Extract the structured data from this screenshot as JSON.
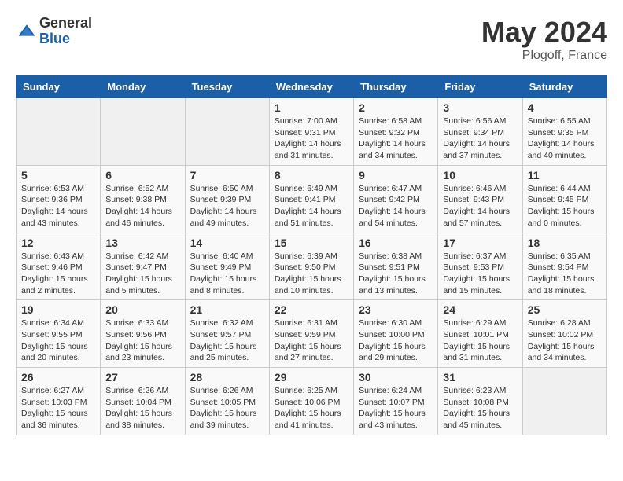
{
  "header": {
    "logo_general": "General",
    "logo_blue": "Blue",
    "month_year": "May 2024",
    "location": "Plogoff, France"
  },
  "days_of_week": [
    "Sunday",
    "Monday",
    "Tuesday",
    "Wednesday",
    "Thursday",
    "Friday",
    "Saturday"
  ],
  "weeks": [
    [
      {
        "day": "",
        "empty": true
      },
      {
        "day": "",
        "empty": true
      },
      {
        "day": "",
        "empty": true
      },
      {
        "day": "1",
        "sunrise": "7:00 AM",
        "sunset": "9:31 PM",
        "daylight": "14 hours and 31 minutes."
      },
      {
        "day": "2",
        "sunrise": "6:58 AM",
        "sunset": "9:32 PM",
        "daylight": "14 hours and 34 minutes."
      },
      {
        "day": "3",
        "sunrise": "6:56 AM",
        "sunset": "9:34 PM",
        "daylight": "14 hours and 37 minutes."
      },
      {
        "day": "4",
        "sunrise": "6:55 AM",
        "sunset": "9:35 PM",
        "daylight": "14 hours and 40 minutes."
      }
    ],
    [
      {
        "day": "5",
        "sunrise": "6:53 AM",
        "sunset": "9:36 PM",
        "daylight": "14 hours and 43 minutes."
      },
      {
        "day": "6",
        "sunrise": "6:52 AM",
        "sunset": "9:38 PM",
        "daylight": "14 hours and 46 minutes."
      },
      {
        "day": "7",
        "sunrise": "6:50 AM",
        "sunset": "9:39 PM",
        "daylight": "14 hours and 49 minutes."
      },
      {
        "day": "8",
        "sunrise": "6:49 AM",
        "sunset": "9:41 PM",
        "daylight": "14 hours and 51 minutes."
      },
      {
        "day": "9",
        "sunrise": "6:47 AM",
        "sunset": "9:42 PM",
        "daylight": "14 hours and 54 minutes."
      },
      {
        "day": "10",
        "sunrise": "6:46 AM",
        "sunset": "9:43 PM",
        "daylight": "14 hours and 57 minutes."
      },
      {
        "day": "11",
        "sunrise": "6:44 AM",
        "sunset": "9:45 PM",
        "daylight": "15 hours and 0 minutes."
      }
    ],
    [
      {
        "day": "12",
        "sunrise": "6:43 AM",
        "sunset": "9:46 PM",
        "daylight": "15 hours and 2 minutes."
      },
      {
        "day": "13",
        "sunrise": "6:42 AM",
        "sunset": "9:47 PM",
        "daylight": "15 hours and 5 minutes."
      },
      {
        "day": "14",
        "sunrise": "6:40 AM",
        "sunset": "9:49 PM",
        "daylight": "15 hours and 8 minutes."
      },
      {
        "day": "15",
        "sunrise": "6:39 AM",
        "sunset": "9:50 PM",
        "daylight": "15 hours and 10 minutes."
      },
      {
        "day": "16",
        "sunrise": "6:38 AM",
        "sunset": "9:51 PM",
        "daylight": "15 hours and 13 minutes."
      },
      {
        "day": "17",
        "sunrise": "6:37 AM",
        "sunset": "9:53 PM",
        "daylight": "15 hours and 15 minutes."
      },
      {
        "day": "18",
        "sunrise": "6:35 AM",
        "sunset": "9:54 PM",
        "daylight": "15 hours and 18 minutes."
      }
    ],
    [
      {
        "day": "19",
        "sunrise": "6:34 AM",
        "sunset": "9:55 PM",
        "daylight": "15 hours and 20 minutes."
      },
      {
        "day": "20",
        "sunrise": "6:33 AM",
        "sunset": "9:56 PM",
        "daylight": "15 hours and 23 minutes."
      },
      {
        "day": "21",
        "sunrise": "6:32 AM",
        "sunset": "9:57 PM",
        "daylight": "15 hours and 25 minutes."
      },
      {
        "day": "22",
        "sunrise": "6:31 AM",
        "sunset": "9:59 PM",
        "daylight": "15 hours and 27 minutes."
      },
      {
        "day": "23",
        "sunrise": "6:30 AM",
        "sunset": "10:00 PM",
        "daylight": "15 hours and 29 minutes."
      },
      {
        "day": "24",
        "sunrise": "6:29 AM",
        "sunset": "10:01 PM",
        "daylight": "15 hours and 31 minutes."
      },
      {
        "day": "25",
        "sunrise": "6:28 AM",
        "sunset": "10:02 PM",
        "daylight": "15 hours and 34 minutes."
      }
    ],
    [
      {
        "day": "26",
        "sunrise": "6:27 AM",
        "sunset": "10:03 PM",
        "daylight": "15 hours and 36 minutes."
      },
      {
        "day": "27",
        "sunrise": "6:26 AM",
        "sunset": "10:04 PM",
        "daylight": "15 hours and 38 minutes."
      },
      {
        "day": "28",
        "sunrise": "6:26 AM",
        "sunset": "10:05 PM",
        "daylight": "15 hours and 39 minutes."
      },
      {
        "day": "29",
        "sunrise": "6:25 AM",
        "sunset": "10:06 PM",
        "daylight": "15 hours and 41 minutes."
      },
      {
        "day": "30",
        "sunrise": "6:24 AM",
        "sunset": "10:07 PM",
        "daylight": "15 hours and 43 minutes."
      },
      {
        "day": "31",
        "sunrise": "6:23 AM",
        "sunset": "10:08 PM",
        "daylight": "15 hours and 45 minutes."
      },
      {
        "day": "",
        "empty": true
      }
    ]
  ],
  "labels": {
    "sunrise_prefix": "Sunrise: ",
    "sunset_prefix": "Sunset: ",
    "daylight_prefix": "Daylight: "
  }
}
